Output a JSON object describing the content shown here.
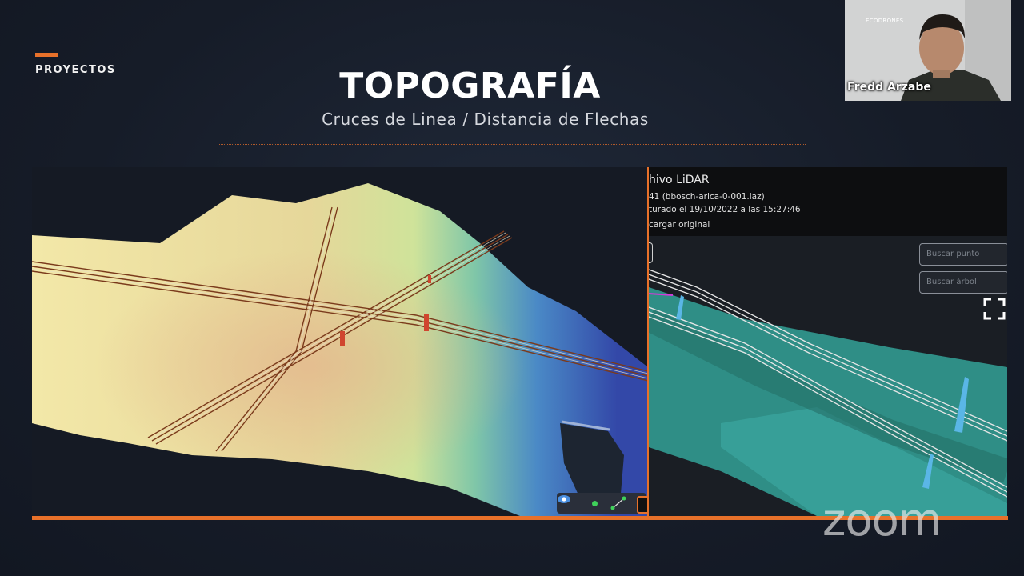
{
  "slide": {
    "section_label": "PROYECTOS",
    "title": "TOPOGRAFÍA",
    "subtitle": "Cruces de Linea / Distancia de Flechas",
    "accent_color": "#e8712a"
  },
  "lidar_panel": {
    "title": "hivo LiDAR",
    "file_line": "41 (bbosch-arica-0-001.laz)",
    "captured_line": "turado el 19/10/2022 a las 15:27:46",
    "download_link": "cargar original",
    "search_point_placeholder": "Buscar punto",
    "search_tree_placeholder": "Buscar árbol",
    "fullscreen_icon": "fullscreen-icon"
  },
  "viewer_toolbar": {
    "icons": [
      "eye-icon",
      "point-tool-icon",
      "line-measure-icon",
      "box-tool-icon"
    ]
  },
  "webcam": {
    "participant_name": "Fredd Arzabe",
    "logo_text": "ECODRONES"
  },
  "watermark": "zoom"
}
